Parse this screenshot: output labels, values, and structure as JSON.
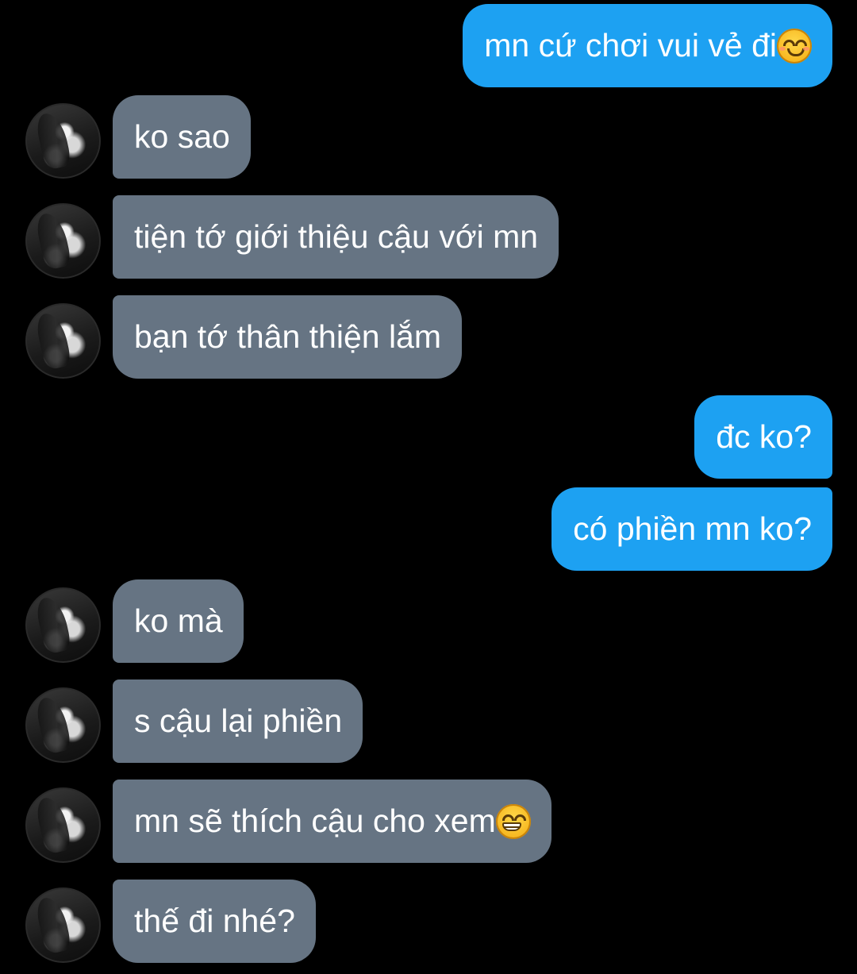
{
  "chat": {
    "theme": {
      "background": "#000000",
      "incoming_bubble": "#667483",
      "outgoing_bubble": "#1da1f2",
      "text": "#ffffff"
    },
    "messages": [
      {
        "id": "m1",
        "direction": "outgoing",
        "text": "mn cứ chơi vui vẻ đi",
        "emoji": "smiling-face-with-smiling-eyes"
      },
      {
        "id": "m2",
        "direction": "incoming",
        "text": "ko sao"
      },
      {
        "id": "m3",
        "direction": "incoming",
        "text": "tiện tớ giới thiệu cậu với mn"
      },
      {
        "id": "m4",
        "direction": "incoming",
        "text": "bạn tớ thân thiện lắm"
      },
      {
        "id": "m5",
        "direction": "outgoing",
        "text": "đc ko?"
      },
      {
        "id": "m6",
        "direction": "outgoing",
        "text": "có phiền mn ko?"
      },
      {
        "id": "m7",
        "direction": "incoming",
        "text": "ko mà"
      },
      {
        "id": "m8",
        "direction": "incoming",
        "text": "s cậu lại phiền"
      },
      {
        "id": "m9",
        "direction": "incoming",
        "text": "mn sẽ thích cậu cho xem",
        "emoji": "beaming-face-with-smiling-eyes"
      },
      {
        "id": "m10",
        "direction": "incoming",
        "text": "thế đi nhé?"
      }
    ],
    "avatar_icon": "contact-avatar"
  }
}
